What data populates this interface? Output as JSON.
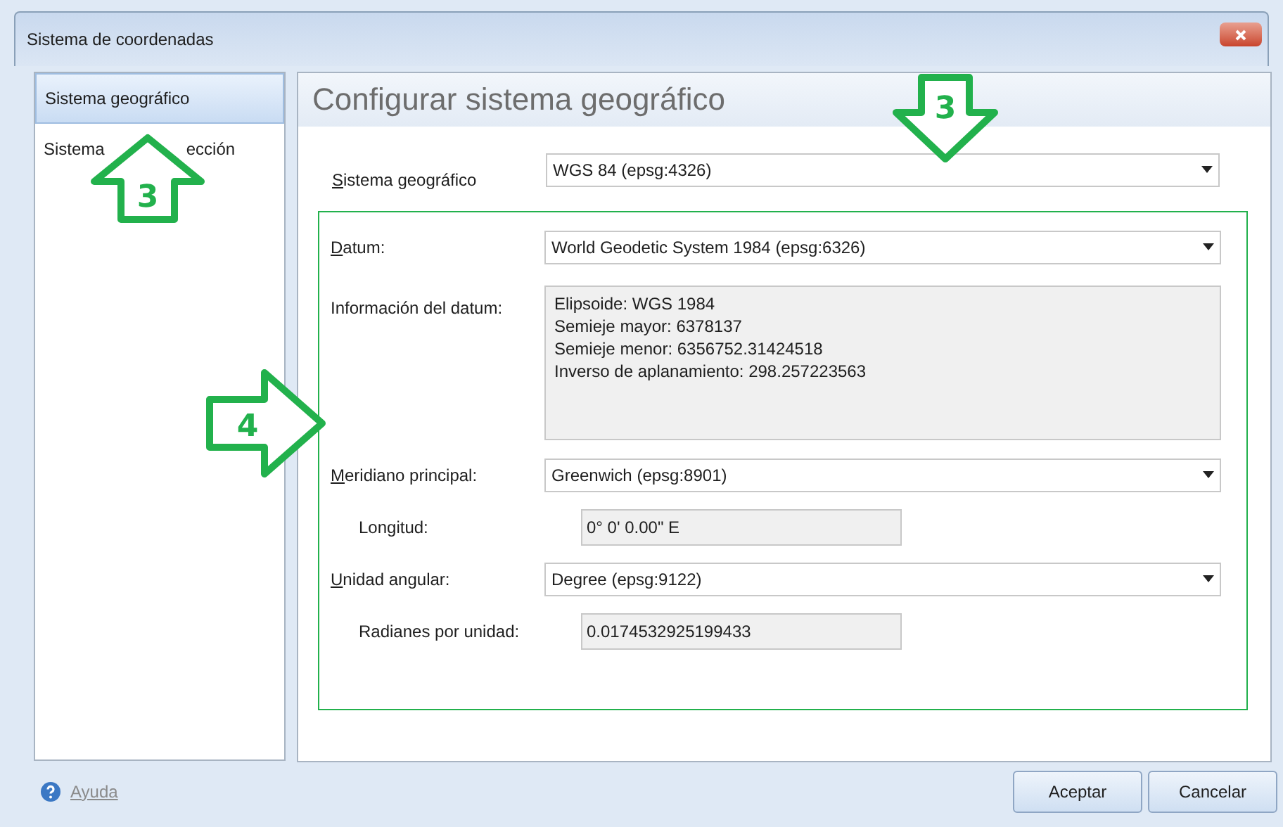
{
  "window": {
    "title": "Sistema de coordenadas"
  },
  "sidebar": {
    "items": [
      {
        "label": "Sistema geográfico",
        "selected": true
      },
      {
        "label_parts": [
          "Sistema",
          "ección"
        ],
        "selected": false
      }
    ]
  },
  "panel": {
    "heading": "Configurar sistema geográfico",
    "system": {
      "label": "Sistema geográfico",
      "mnemonic": true,
      "value": "WGS 84 (epsg:4326)"
    },
    "group": [
      {
        "kind": "combo",
        "label": "Datum:",
        "mnemonic": true,
        "value": "World Geodetic System 1984 (epsg:6326)"
      },
      {
        "kind": "info",
        "label": "Información del datum:",
        "lines": [
          "Elipsoide: WGS 1984",
          "Semieje mayor: 6378137",
          "Semieje menor: 6356752.31424518",
          "Inverso de aplanamiento: 298.257223563"
        ]
      },
      {
        "kind": "combo",
        "label": "Meridiano principal:",
        "mnemonic": true,
        "value": "Greenwich (epsg:8901)"
      },
      {
        "kind": "readonly",
        "label": "Longitud:",
        "value": "0° 0' 0.00\" E"
      },
      {
        "kind": "combo",
        "label": "Unidad angular:",
        "mnemonic": true,
        "value": "Degree (epsg:9122)"
      },
      {
        "kind": "readonly",
        "label": "Radianes por unidad:",
        "value": "0.0174532925199433"
      }
    ]
  },
  "footer": {
    "help": "Ayuda",
    "buttons": [
      "Aceptar",
      "Cancelar"
    ]
  },
  "annotations": [
    {
      "kind": "up",
      "label": "3"
    },
    {
      "kind": "down",
      "label": "3"
    },
    {
      "kind": "right",
      "label": "4"
    }
  ]
}
